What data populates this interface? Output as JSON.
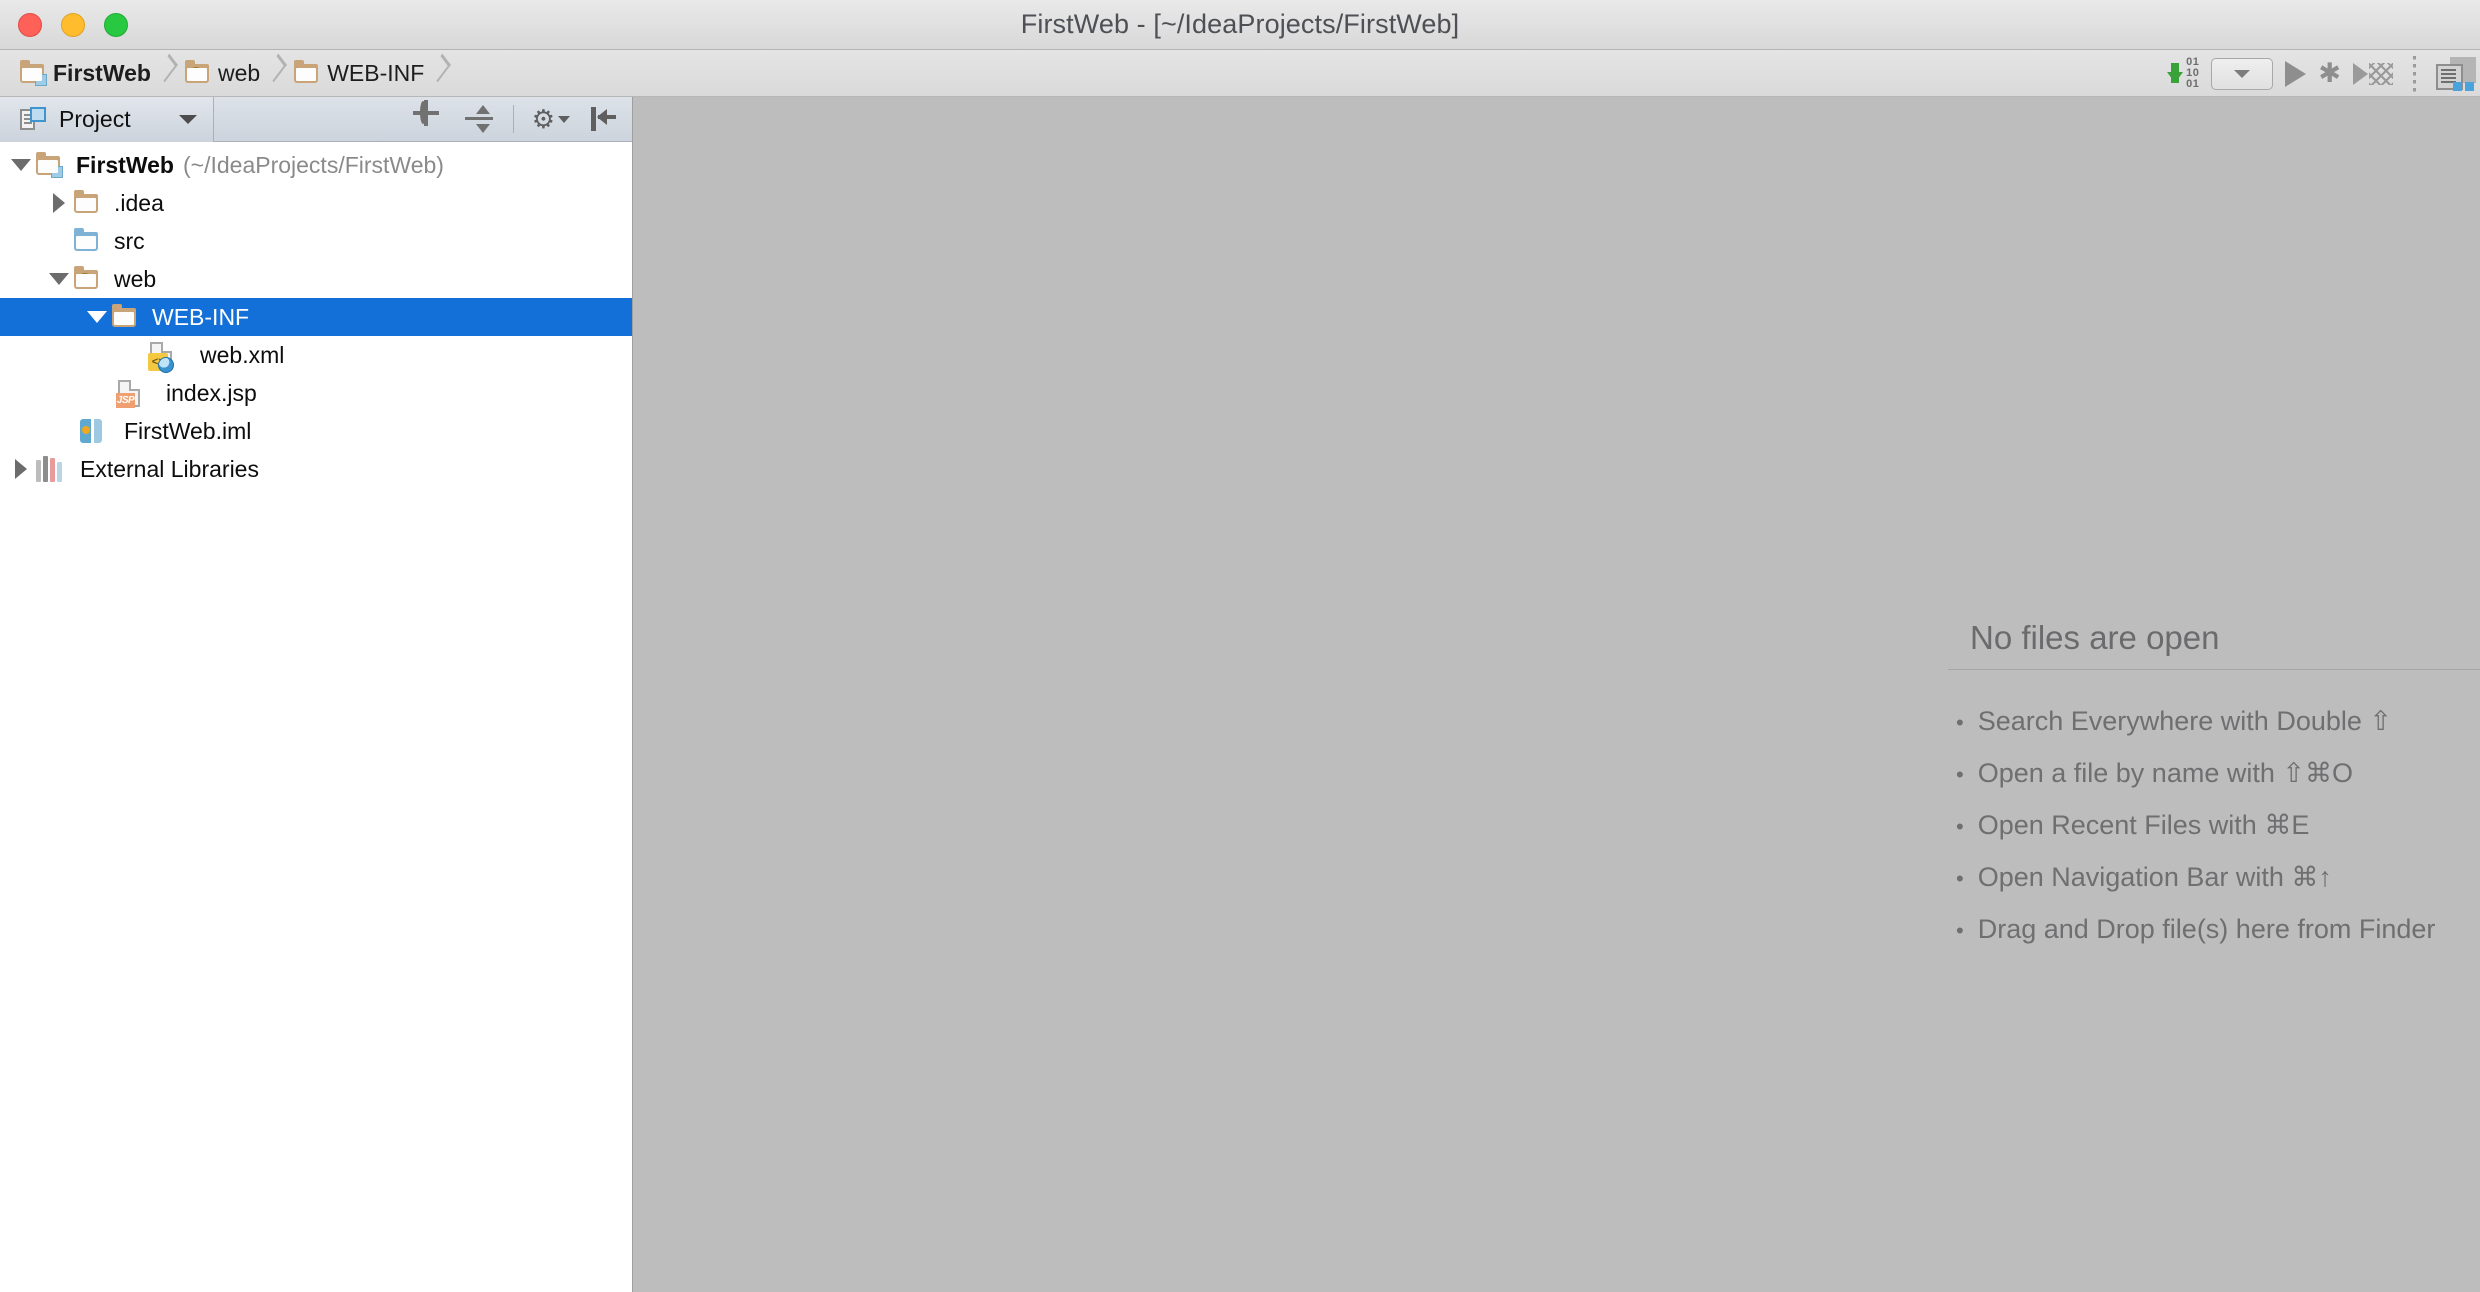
{
  "window": {
    "title": "FirstWeb - [~/IdeaProjects/FirstWeb]",
    "controls": {
      "close": "close",
      "minimize": "minimize",
      "maximize": "maximize"
    }
  },
  "navbar": {
    "breadcrumbs": [
      {
        "label": "FirstWeb",
        "icon": "folder-module-icon"
      },
      {
        "label": "web",
        "icon": "folder-web-icon"
      },
      {
        "label": "WEB-INF",
        "icon": "folder-icon"
      }
    ],
    "toolbar": [
      {
        "name": "make-project-button",
        "icon": "make-hammer-icon",
        "bits": [
          "01",
          "10",
          "01"
        ]
      },
      {
        "name": "run-configuration-selector",
        "icon": "chevron-down-icon"
      },
      {
        "name": "run-button",
        "icon": "play-icon"
      },
      {
        "name": "debug-button",
        "icon": "bug-icon",
        "glyph": "✱"
      },
      {
        "name": "run-with-coverage-button",
        "icon": "coverage-icon"
      },
      {
        "name": "project-structure-button",
        "icon": "project-structure-icon"
      }
    ]
  },
  "project_panel": {
    "tab_label": "Project",
    "tab_icon": "project-view-icon",
    "tools": [
      {
        "name": "locate-in-tree-button",
        "icon": "crosshair-target-icon"
      },
      {
        "name": "collapse-all-button",
        "icon": "collapse-all-icon"
      },
      {
        "name": "settings-button",
        "icon": "gear-icon",
        "glyph": "⚙"
      },
      {
        "name": "hide-panel-button",
        "icon": "hide-panel-icon"
      }
    ],
    "tree": [
      {
        "label": "FirstWeb",
        "sub": "(~/IdeaProjects/FirstWeb)",
        "icon": "folder-module-icon",
        "indent": 0,
        "twisty": "open",
        "bold": true,
        "selected": false
      },
      {
        "label": ".idea",
        "sub": "",
        "icon": "folder-icon",
        "indent": 1,
        "twisty": "closed",
        "bold": false,
        "selected": false
      },
      {
        "label": "src",
        "sub": "",
        "icon": "folder-source-icon",
        "indent": 1,
        "twisty": "none",
        "bold": false,
        "selected": false
      },
      {
        "label": "web",
        "sub": "",
        "icon": "folder-web-icon",
        "indent": 1,
        "twisty": "open",
        "bold": false,
        "selected": false
      },
      {
        "label": "WEB-INF",
        "sub": "",
        "icon": "folder-icon",
        "indent": 2,
        "twisty": "open",
        "bold": false,
        "selected": true
      },
      {
        "label": "web.xml",
        "sub": "",
        "icon": "xml-web-file-icon",
        "indent": 3,
        "twisty": "none",
        "bold": false,
        "selected": false
      },
      {
        "label": "index.jsp",
        "sub": "",
        "icon": "jsp-file-icon",
        "indent": 2,
        "twisty": "none",
        "bold": false,
        "selected": false
      },
      {
        "label": "FirstWeb.iml",
        "sub": "",
        "icon": "iml-module-file-icon",
        "indent": 1,
        "twisty": "none",
        "bold": false,
        "selected": false
      },
      {
        "label": "External Libraries",
        "sub": "",
        "icon": "libraries-icon",
        "indent": 0,
        "twisty": "closed",
        "bold": false,
        "selected": false
      }
    ]
  },
  "editor": {
    "empty_title": "No files are open",
    "tips": [
      "Search Everywhere with Double ⇧",
      "Open a file by name with ⇧⌘O",
      "Open Recent Files with ⌘E",
      "Open Navigation Bar with ⌘↑",
      "Drag and Drop file(s) here from Finder"
    ],
    "bullet": "•"
  },
  "colors": {
    "selection_blue": "#1370d8",
    "editor_background": "#bdbdbd",
    "panel_background": "#ffffff",
    "folder_tan": "#c8a478",
    "folder_blue": "#7fb2d4",
    "make_green": "#3aa23a"
  }
}
